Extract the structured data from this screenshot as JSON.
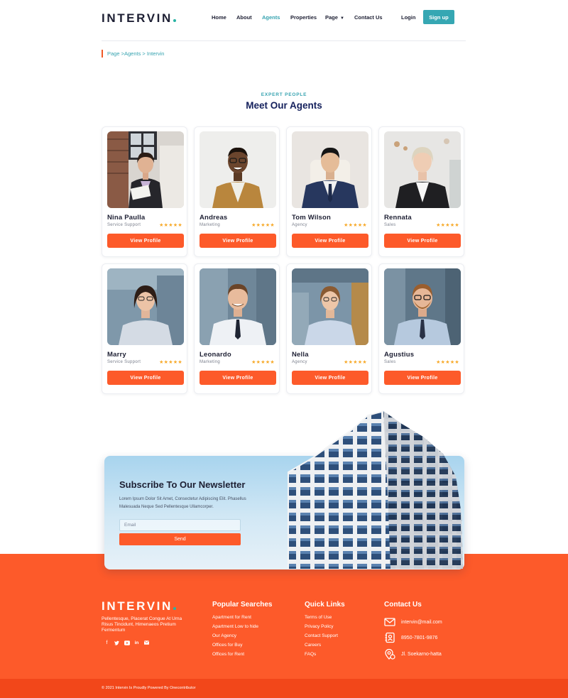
{
  "header": {
    "logo": "INTERVIN",
    "nav": [
      {
        "label": "Home"
      },
      {
        "label": "About"
      },
      {
        "label": "Agents",
        "active": true
      },
      {
        "label": "Properties"
      },
      {
        "label": "Page",
        "dropdown": true
      },
      {
        "label": "Contact Us"
      }
    ],
    "login": "Login",
    "signup": "Sign up"
  },
  "breadcrumb": "Page >Agents > Intervin",
  "section": {
    "eyebrow": "EXPERT PEOPLE",
    "title": "Meet Our Agents"
  },
  "agents": [
    {
      "name": "Nina Paulla",
      "role": "Service Support",
      "rating": 5,
      "stars": "★★★★★",
      "button": "View Profile"
    },
    {
      "name": "Andreas",
      "role": "Marketing",
      "rating": 5,
      "stars": "★★★★★",
      "button": "View Profile"
    },
    {
      "name": "Tom Wilson",
      "role": "Agency",
      "rating": 5,
      "stars": "★★★★★",
      "button": "View Profile"
    },
    {
      "name": "Rennata",
      "role": "Sales",
      "rating": 5,
      "stars": "★★★★★",
      "button": "View Profile"
    },
    {
      "name": "Marry",
      "role": "Service Support",
      "rating": 5,
      "stars": "★★★★★",
      "button": "View Profile"
    },
    {
      "name": "Leonardo",
      "role": "Marketing",
      "rating": 5,
      "stars": "★★★★★",
      "button": "View Profile"
    },
    {
      "name": "Nella",
      "role": "Agency",
      "rating": 5,
      "stars": "★★★★★",
      "button": "View Profile"
    },
    {
      "name": "Agustius",
      "role": "Sales",
      "rating": 5,
      "stars": "★★★★★",
      "button": "View Profile"
    }
  ],
  "newsletter": {
    "title": "Subscribe To Our Newsletter",
    "text": "Lorem Ipsum Dolor Sit Amet, Consectetur Adipiscing Elit. Phasellus Malesuada Neque Sed Pellentesque Ullamcorper.",
    "email_placeholder": "Email",
    "send": "Send"
  },
  "footer": {
    "logo": "INTERVIN",
    "description": "Pellentesque, Placerat Congue At Urna Risus Tincidunt, Himenaeos Pretium Fermentum",
    "socials": [
      "facebook-icon",
      "twitter-icon",
      "youtube-icon",
      "linkedin-icon",
      "mail-icon"
    ],
    "popular": {
      "title": "Popular Searches",
      "items": [
        "Apartment for Rent",
        "Apartment Low to hide",
        "Our Agency",
        "Offices for Buy",
        "Offices for Rent"
      ]
    },
    "quick": {
      "title": "Quick Links",
      "items": [
        "Terms of Use",
        "Privacy Policy",
        "Contact Support",
        "Careers",
        "FAQs"
      ]
    },
    "contact": {
      "title": "Contact Us",
      "email": "intervin@mail.com",
      "phone": "8950-7801-9876",
      "address": "Jl. Soekarno-hatta"
    },
    "copyright": "© 2021 Intervin Is Proudly Powered By Onecontributor"
  },
  "colors": {
    "accent_teal": "#36a7b3",
    "accent_orange": "#fd5a2a",
    "title_navy": "#14205c",
    "star": "#f7a928"
  }
}
